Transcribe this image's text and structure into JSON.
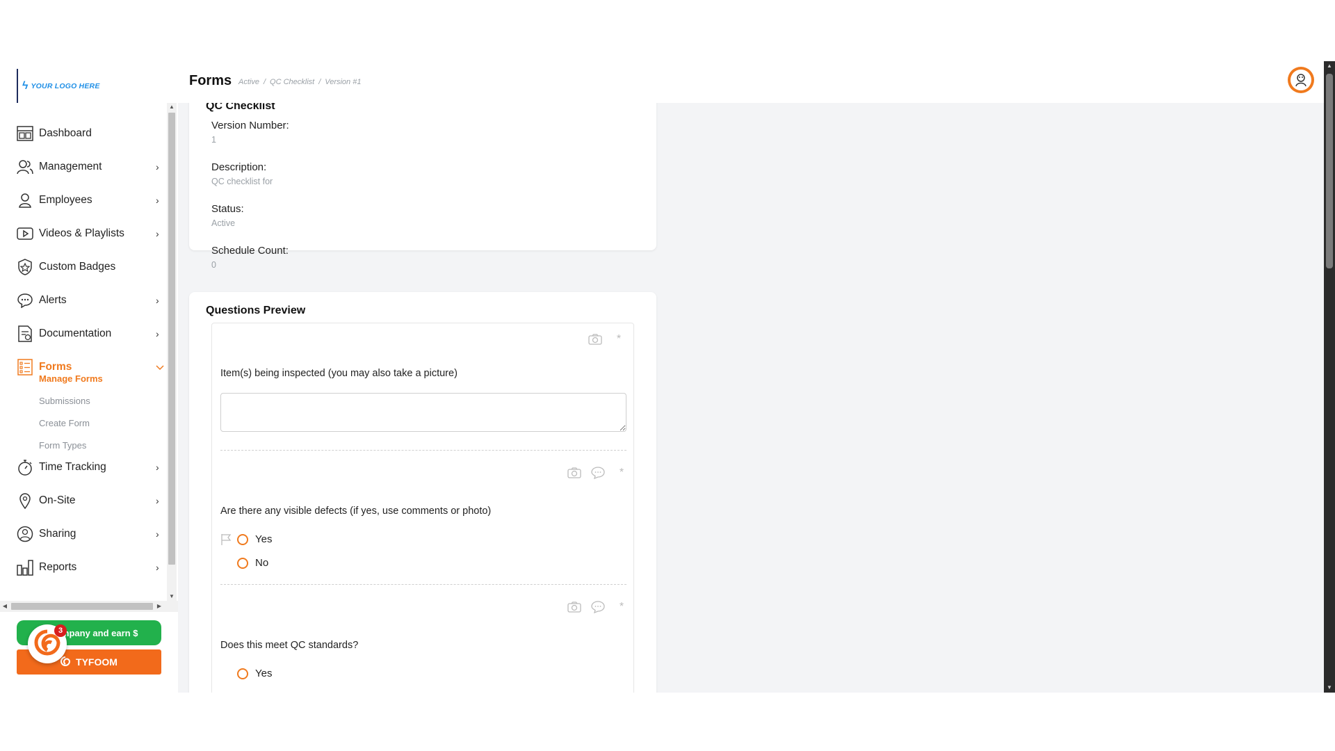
{
  "header": {
    "logo_text": "YOUR LOGO HERE",
    "title": "Forms",
    "breadcrumb": [
      "Active",
      "/",
      "QC Checklist",
      "/",
      "Version #1"
    ]
  },
  "sidebar": {
    "items": [
      {
        "label": "Dashboard",
        "icon": "dashboard-icon",
        "has_chevron": false
      },
      {
        "label": "Management",
        "icon": "management-icon",
        "has_chevron": true
      },
      {
        "label": "Employees",
        "icon": "employee-icon",
        "has_chevron": true
      },
      {
        "label": "Videos & Playlists",
        "icon": "video-icon",
        "has_chevron": true
      },
      {
        "label": "Custom Badges",
        "icon": "badge-icon",
        "has_chevron": false
      },
      {
        "label": "Alerts",
        "icon": "alert-icon",
        "has_chevron": true
      },
      {
        "label": "Documentation",
        "icon": "documentation-icon",
        "has_chevron": true
      },
      {
        "label": "Forms",
        "icon": "forms-icon",
        "has_chevron": true,
        "active": true
      },
      {
        "label": "Time Tracking",
        "icon": "stopwatch-icon",
        "has_chevron": true
      },
      {
        "label": "On-Site",
        "icon": "location-pin-icon",
        "has_chevron": true
      },
      {
        "label": "Sharing",
        "icon": "sharing-icon",
        "has_chevron": true
      },
      {
        "label": "Reports",
        "icon": "reports-icon",
        "has_chevron": true
      }
    ],
    "forms_subitems": [
      {
        "label": "Manage Forms",
        "active": true
      },
      {
        "label": "Submissions"
      },
      {
        "label": "Create Form"
      },
      {
        "label": "Form Types"
      }
    ],
    "refer_button": "R…ompany and earn $",
    "tyfoom_button": "TYFOOM",
    "chat_badge_count": "3"
  },
  "form_info": {
    "title": "QC Checklist",
    "fields": [
      {
        "label": "Version Number:",
        "value": "1"
      },
      {
        "label": "Description:",
        "value": "QC checklist for"
      },
      {
        "label": "Status:",
        "value": "Active"
      },
      {
        "label": "Schedule Count:",
        "value": "0"
      }
    ]
  },
  "questions_preview": {
    "title": "Questions Preview",
    "questions": [
      {
        "text": "Item(s) being inspected (you may also take a picture)",
        "type": "text"
      },
      {
        "text": "Are there any visible defects (if yes, use comments or photo)",
        "type": "radio",
        "options": [
          "Yes",
          "No"
        ]
      },
      {
        "text": "Does this meet QC standards?",
        "type": "radio",
        "options": [
          "Yes"
        ]
      }
    ]
  },
  "colors": {
    "accent": "#f07a1e",
    "refer_green": "#22b14c",
    "tyfoom_orange": "#f26a1b"
  }
}
